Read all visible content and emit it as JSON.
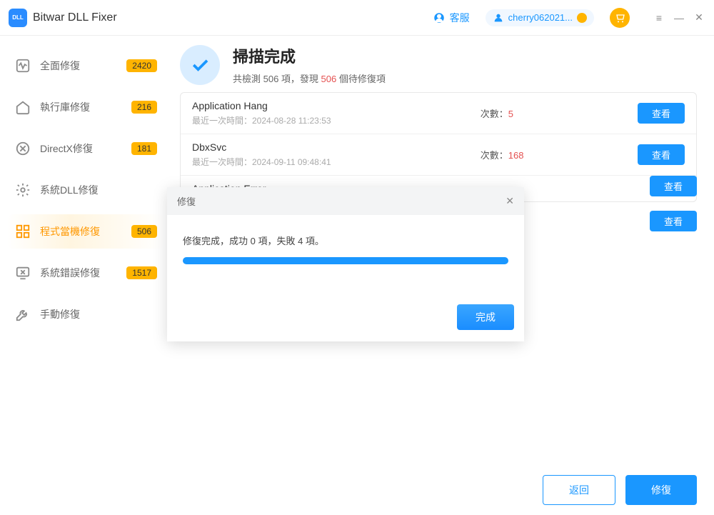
{
  "app": {
    "title": "Bitwar DLL Fixer"
  },
  "header": {
    "support_label": "客服",
    "user_name": "cherry062021..."
  },
  "sidebar": {
    "items": [
      {
        "label": "全面修復",
        "badge": "2420"
      },
      {
        "label": "執行庫修復",
        "badge": "216"
      },
      {
        "label": "DirectX修復",
        "badge": "181"
      },
      {
        "label": "系統DLL修復",
        "badge": ""
      },
      {
        "label": "程式當機修復",
        "badge": "506"
      },
      {
        "label": "系統錯誤修復",
        "badge": "1517"
      },
      {
        "label": "手動修復",
        "badge": ""
      }
    ]
  },
  "scan": {
    "title": "掃描完成",
    "sub_prefix": "共檢測 506 項，發現 ",
    "sub_count": "506",
    "sub_suffix": " 個待修復項"
  },
  "list": [
    {
      "name": "Application Hang",
      "time_label": "最近一次時間：2024-08-28 11:23:53",
      "count_label": "次數：",
      "count": "5",
      "view": "查看"
    },
    {
      "name": "DbxSvc",
      "time_label": "最近一次時間：2024-09-11 09:48:41",
      "count_label": "次數：",
      "count": "168",
      "view": "查看"
    },
    {
      "name": "Application Error",
      "time_label": "",
      "count_label": "",
      "count": "",
      "view": "查看"
    }
  ],
  "extra_view": "查看",
  "footer": {
    "back": "返回",
    "repair": "修復"
  },
  "modal": {
    "title": "修復",
    "message": "修復完成，成功 0 項，失敗 4 項。",
    "done": "完成"
  }
}
